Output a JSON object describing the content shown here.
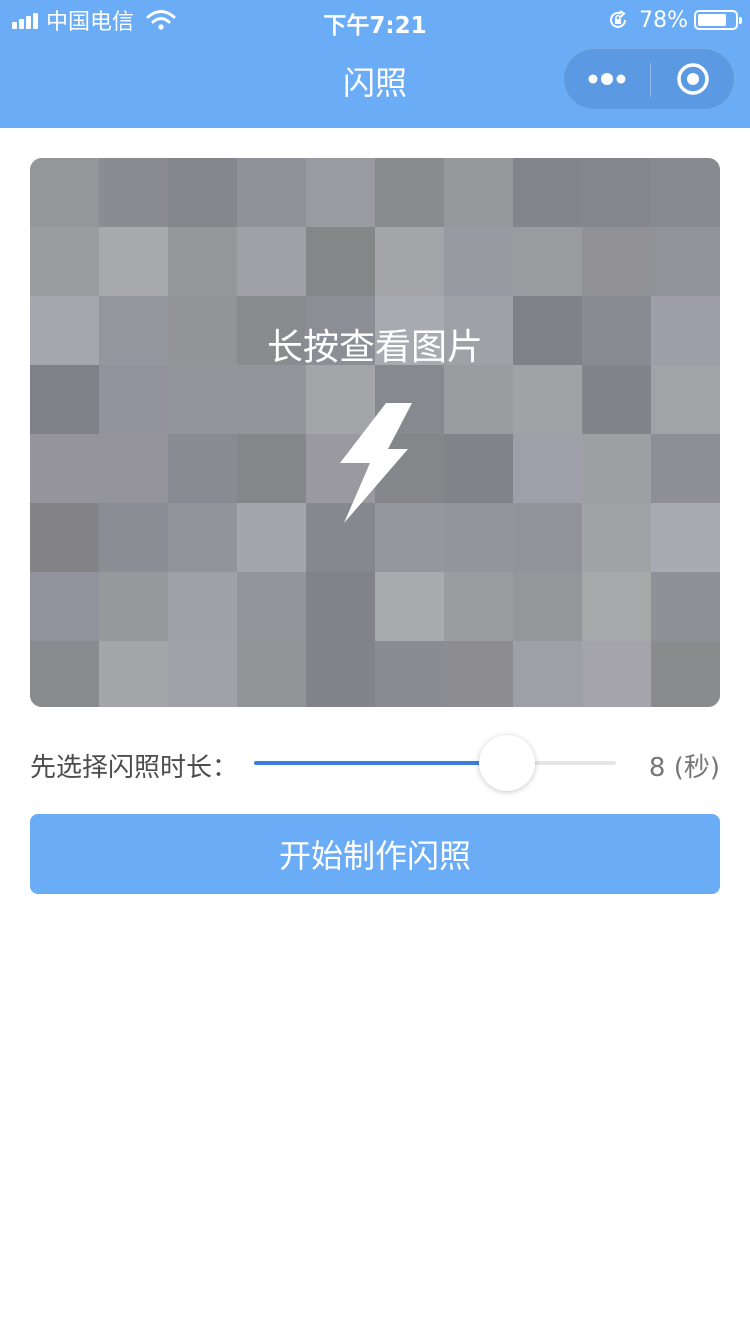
{
  "status_bar": {
    "carrier": "中国电信",
    "time": "下午7:21",
    "battery": "78%",
    "battery_level": 0.78
  },
  "nav": {
    "title": "闪照",
    "more_icon": "more-dots-icon",
    "close_icon": "close-circle-icon"
  },
  "photo": {
    "hint": "长按查看图片",
    "icon": "lightning-bolt-icon"
  },
  "duration": {
    "label": "先选择闪照时长：",
    "value": 8,
    "value_text": "8",
    "unit": "(秒)",
    "fill_fraction": 0.7
  },
  "start_button": {
    "label": "开始制作闪照"
  },
  "colors": {
    "brand": "#6aacf5",
    "slider_active": "#3a7fe0"
  }
}
